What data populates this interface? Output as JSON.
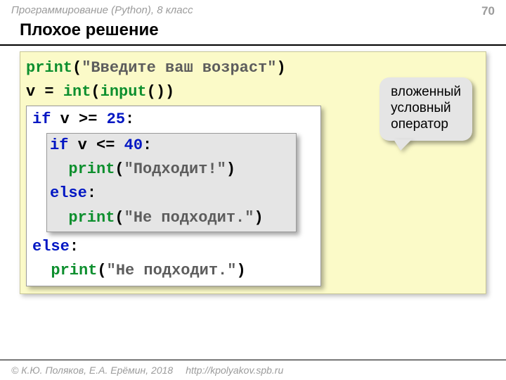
{
  "header": {
    "course": "Программирование (Python), 8 класс",
    "page": "70",
    "title": "Плохое решение"
  },
  "code": {
    "l1_print": "print",
    "l1_open": "(",
    "l1_str": "\"Введите ваш возраст\"",
    "l1_close": ")",
    "l2_v": "v = ",
    "l2_int": "int",
    "l2_open": "(",
    "l2_input": "input",
    "l2_paren": "())",
    "if1_kw": "if",
    "if1_cond": " v >= ",
    "if1_num": "25",
    "if1_colon": ":",
    "if2_kw": "if",
    "if2_cond": " v <= ",
    "if2_num": "40",
    "if2_colon": ":",
    "p1_print": "print",
    "p1_open": "(",
    "p1_str": "\"Подходит!\"",
    "p1_close": ")",
    "else1": "else",
    "else1_colon": ":",
    "p2_print": "print",
    "p2_open": "(",
    "p2_str": "\"Не подходит.\"",
    "p2_close": ")",
    "else2": "else",
    "else2_colon": ":",
    "p3_print": "print",
    "p3_open": "(",
    "p3_str": "\"Не подходит.\"",
    "p3_close": ")"
  },
  "callout": {
    "line1": "вложенный",
    "line2": "условный",
    "line3": "оператор"
  },
  "footer": {
    "copyright": "© К.Ю. Поляков, Е.А. Ерёмин, 2018",
    "url": "http://kpolyakov.spb.ru"
  }
}
